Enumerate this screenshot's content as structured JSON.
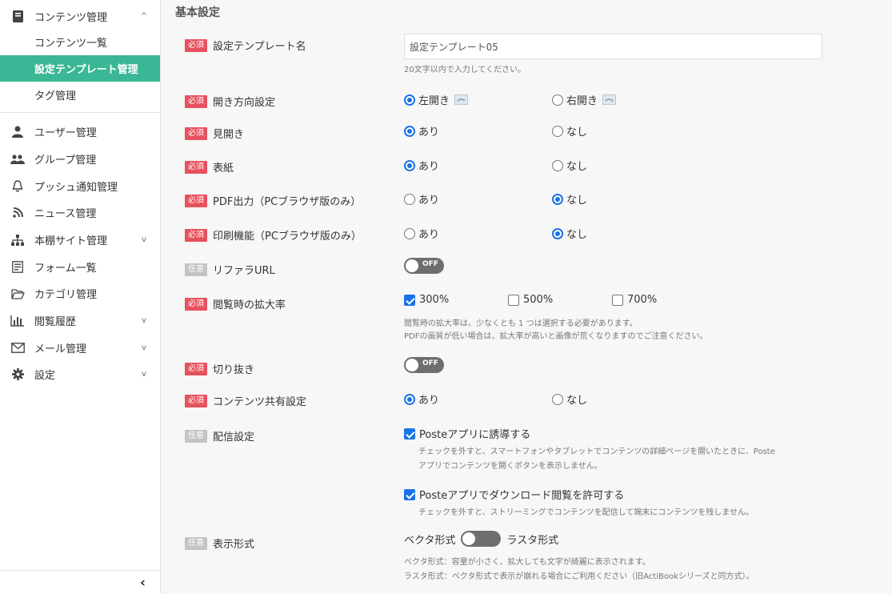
{
  "sidebar": {
    "content_mgmt": "コンテンツ管理",
    "content_list": "コンテンツ一覧",
    "template_mgmt": "設定テンプレート管理",
    "tag_mgmt": "タグ管理",
    "user_mgmt": "ユーザー管理",
    "group_mgmt": "グループ管理",
    "push_mgmt": "プッシュ通知管理",
    "news_mgmt": "ニュース管理",
    "shelf_mgmt": "本棚サイト管理",
    "form_list": "フォーム一覧",
    "category_mgmt": "カテゴリ管理",
    "history": "閲覧履歴",
    "mail_mgmt": "メール管理",
    "settings": "設定",
    "collapse": "‹"
  },
  "main": {
    "section_title": "基本設定",
    "badge_required": "必須",
    "badge_optional": "任意",
    "template_name": {
      "label": "設定テンプレート名",
      "value": "設定テンプレート05",
      "hint": "20文字以内で入力してください。"
    },
    "open_direction": {
      "label": "開き方向設定",
      "opt1": "左開き",
      "opt2": "右開き",
      "selected": "左開き"
    },
    "spread": {
      "label": "見開き",
      "opt1": "あり",
      "opt2": "なし",
      "selected": "あり"
    },
    "cover": {
      "label": "表紙",
      "opt1": "あり",
      "opt2": "なし",
      "selected": "あり"
    },
    "pdf_output": {
      "label": "PDF出力（PCブラウザ版のみ）",
      "opt1": "あり",
      "opt2": "なし",
      "selected": "なし"
    },
    "print": {
      "label": "印刷機能（PCブラウザ版のみ）",
      "opt1": "あり",
      "opt2": "なし",
      "selected": "なし"
    },
    "referrer": {
      "label": "リファラURL",
      "toggle": "OFF"
    },
    "zoom": {
      "label": "閲覧時の拡大率",
      "opt1": "300%",
      "opt2": "500%",
      "opt3": "700%",
      "checked": [
        "300%"
      ],
      "hint1": "閲覧時の拡大率は、少なくとも 1 つは選択する必要があります。",
      "hint2": "PDFの画質が低い場合は、拡大率が高いと画像が荒くなりますのでご注意ください。"
    },
    "crop": {
      "label": "切り抜き",
      "toggle": "OFF"
    },
    "share": {
      "label": "コンテンツ共有設定",
      "opt1": "あり",
      "opt2": "なし",
      "selected": "あり"
    },
    "delivery": {
      "label": "配信設定",
      "check1": "Posteアプリに誘導する",
      "hint1a": "チェックを外すと、スマートフォンやタブレットでコンテンツの詳細ページを開いたときに、Poste",
      "hint1b": "アプリでコンテンツを開くボタンを表示しません。",
      "check2": "Posteアプリでダウンロード閲覧を許可する",
      "hint2": "チェックを外すと、ストリーミングでコンテンツを配信して端末にコンテンツを残しません。"
    },
    "display_format": {
      "label": "表示形式",
      "left": "ベクタ形式",
      "right": "ラスタ形式",
      "hint1": "ベクタ形式：容量が小さく、拡大しても文字が綺麗に表示されます。",
      "hint2": "ラスタ形式：ベクタ形式で表示が崩れる場合にご利用ください（旧ActiBookシリーズと同方式）。"
    }
  },
  "colors": {
    "accent": "#3ab795",
    "required": "#e7515e",
    "optional": "#c4c4c4",
    "radio": "#1a73e8"
  }
}
